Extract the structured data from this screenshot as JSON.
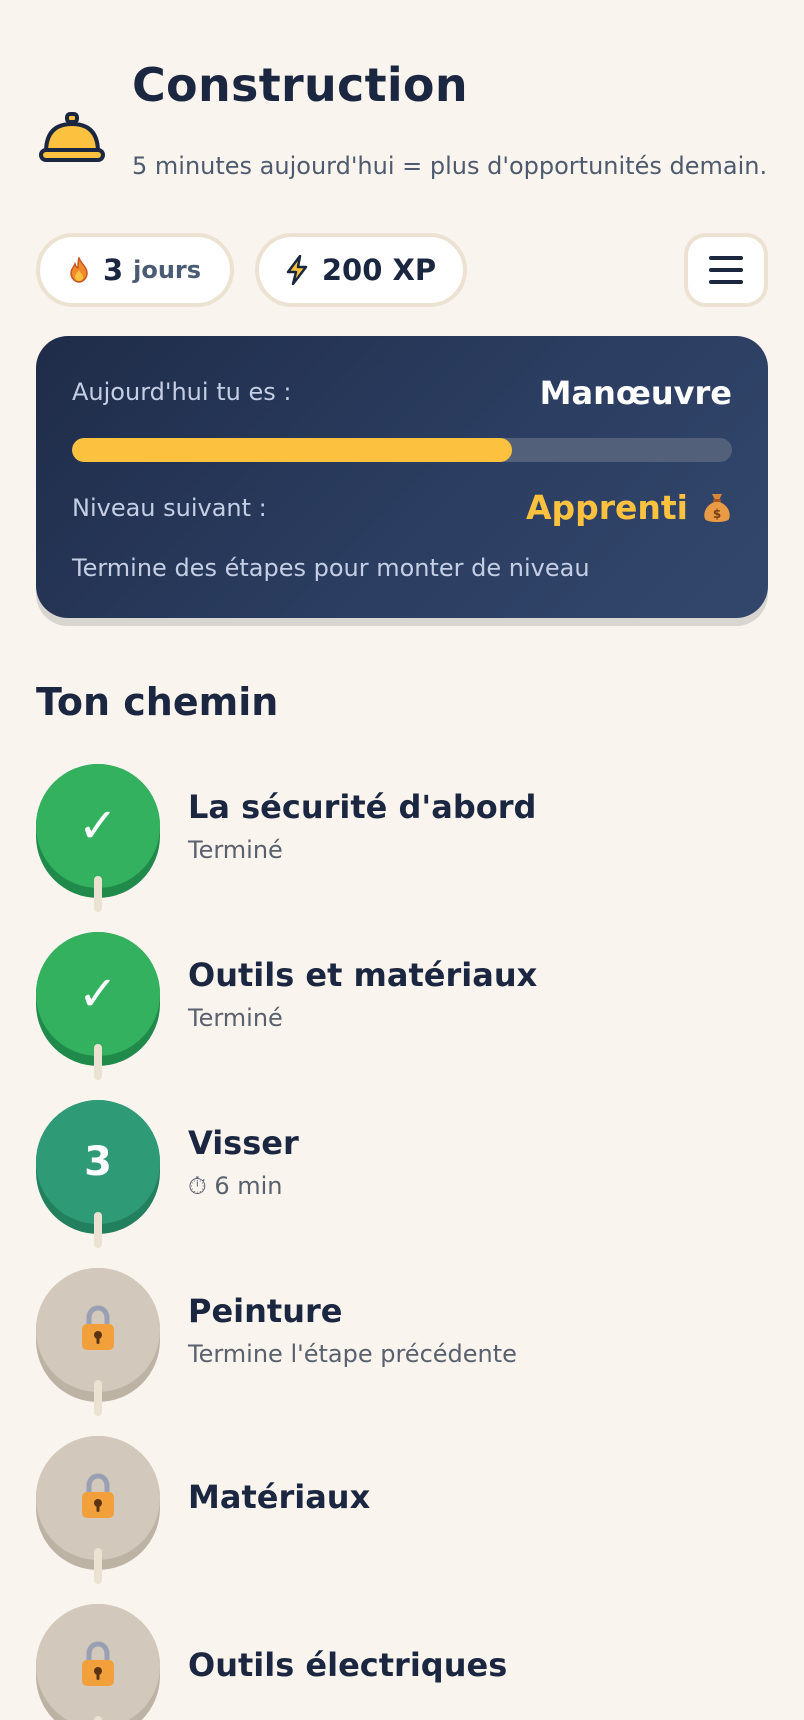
{
  "header": {
    "icon": "service-bell-icon",
    "title": "Construction",
    "subtitle": "5 minutes aujourd'hui = plus d'opportunités demain."
  },
  "stats": {
    "streak_icon": "flame-icon",
    "streak_value": "3",
    "streak_unit": "jours",
    "xp_icon": "lightning-icon",
    "xp_label": "200 XP",
    "menu_icon": "hamburger-menu-icon"
  },
  "level": {
    "today_label": "Aujourd'hui tu es :",
    "current_level": "Manœuvre",
    "progress_fraction": 0.667,
    "next_label": "Niveau suivant :",
    "next_level": "Apprenti",
    "next_icon": "money-bag-icon",
    "hint": "Termine des étapes pour monter de niveau"
  },
  "path": {
    "title": "Ton chemin",
    "steps": [
      {
        "name": "La sécurité d'abord",
        "status": "done",
        "subtitle": "Terminé",
        "badge": "✓"
      },
      {
        "name": "Outils et matériaux",
        "status": "done",
        "subtitle": "Terminé",
        "badge": "✓"
      },
      {
        "name": "Visser",
        "status": "current",
        "subtitle": "⏱ 6 min",
        "badge": "3"
      },
      {
        "name": "Peinture",
        "status": "locked",
        "subtitle": "Termine l'étape précédente",
        "badge": "lock-icon"
      },
      {
        "name": "Matériaux",
        "status": "locked",
        "subtitle": "",
        "badge": "lock-icon"
      },
      {
        "name": "Outils électriques",
        "status": "locked",
        "subtitle": "",
        "badge": "lock-icon"
      }
    ]
  },
  "colors": {
    "background": "#f9f4ee",
    "navy": "#1b2740",
    "accent_yellow": "#fcc23f",
    "done_green": "#33b15f",
    "current_green": "#2f9b76",
    "locked_gray": "#d2c8bb"
  }
}
